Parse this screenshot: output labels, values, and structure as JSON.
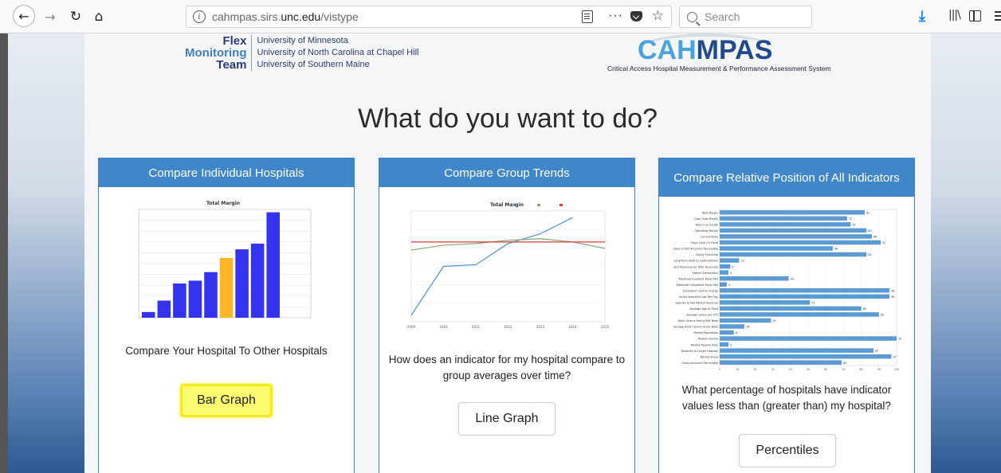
{
  "browser": {
    "url_prefix": "cahmpas.sirs.",
    "url_domain": "unc.edu",
    "url_path": "/vistype",
    "search_placeholder": "Search"
  },
  "header": {
    "fmt_logo": {
      "words": [
        "Flex",
        "Monitoring",
        "Team"
      ],
      "universities": [
        "University of Minnesota",
        "University of North Carolina at Chapel Hill",
        "University of Southern Maine"
      ]
    },
    "cahmpas_logo": {
      "word_a": "CAH",
      "word_b": "MPAS",
      "subtitle": "Critical Access Hospital Measurement & Performance Assessment System"
    }
  },
  "page_title": "What do you want to do?",
  "cards": [
    {
      "header": "Compare Individual Hospitals",
      "description": "Compare Your Hospital To Other Hospitals",
      "button": "Bar Graph"
    },
    {
      "header": "Compare Group Trends",
      "description": "How does an indicator for my hospital compare to group averages over time?",
      "button": "Line Graph"
    },
    {
      "header": "Compare Relative Position of All Indicators",
      "description": "What percentage of hospitals have indicator values less than (greater than) my hospital?",
      "button": "Percentiles"
    }
  ],
  "colors": {
    "card_header": "#3f87c9",
    "bar_blue": "#3434f0",
    "bar_highlight": "#ffb626",
    "hbar": "#5b9bd1",
    "line_blue": "#4a90d9",
    "line_green": "#7fa970",
    "line_red": "#e23a3a",
    "button_highlight": "#fdfb70"
  },
  "chart_data": [
    {
      "type": "bar",
      "title": "Total Margin",
      "values": [
        1,
        3,
        6,
        6.5,
        8,
        10.5,
        12,
        13,
        18.5
      ],
      "highlight_index": 5,
      "ylim": [
        0,
        19
      ]
    },
    {
      "type": "line",
      "title": "Total Margin",
      "x": [
        2009,
        2010,
        2011,
        2012,
        2013,
        2014,
        2015
      ],
      "series": [
        {
          "values": [
            -20,
            -5,
            -4.5,
            2,
            5,
            10,
            null
          ]
        },
        {
          "values": [
            0,
            1.5,
            2,
            3,
            3.5,
            2.5,
            0.5
          ]
        },
        {
          "values": [
            2.5,
            2.5,
            2.5,
            2.5,
            2.5,
            2.5,
            2.5
          ]
        }
      ],
      "legend": "top-right"
    },
    {
      "type": "bar",
      "orientation": "horizontal",
      "categories": [
        "Total Margin",
        "Cash Flow Margin",
        "Return on Equity",
        "Operating Margin",
        "Current Ratio",
        "Days Cash On Hand",
        "Days in Net Accounts Receivable",
        "Equity Financing",
        "Long-Term Debt to Capitalization",
        "Patient Revenues to Total Revenues",
        "Patient Deductions",
        "Medicare Inpatient Payer Mix",
        "Medicare Outpatient Payer Mix",
        "Outpatient Cost to Charge",
        "Acute Inpatient Cost Per Day",
        "Salaries to Net Patient Revenue",
        "Average Age of Plant",
        "Average Salary per FTE",
        "Daily Census Swing-SNF Beds",
        "Average Daily Census Acute Beds",
        "Market Population",
        "Market Income",
        "Market Poverty Rate",
        "Distance to Larger Hospital",
        "Market Share",
        "Gross Accounts Receivable"
      ],
      "values": [
        82,
        72,
        74,
        83,
        86,
        91,
        64,
        83,
        11,
        6,
        5,
        39,
        4,
        96,
        96,
        51,
        80,
        90,
        29,
        14,
        8,
        100,
        5,
        87,
        97,
        69
      ],
      "xlim": [
        0,
        100
      ]
    }
  ]
}
